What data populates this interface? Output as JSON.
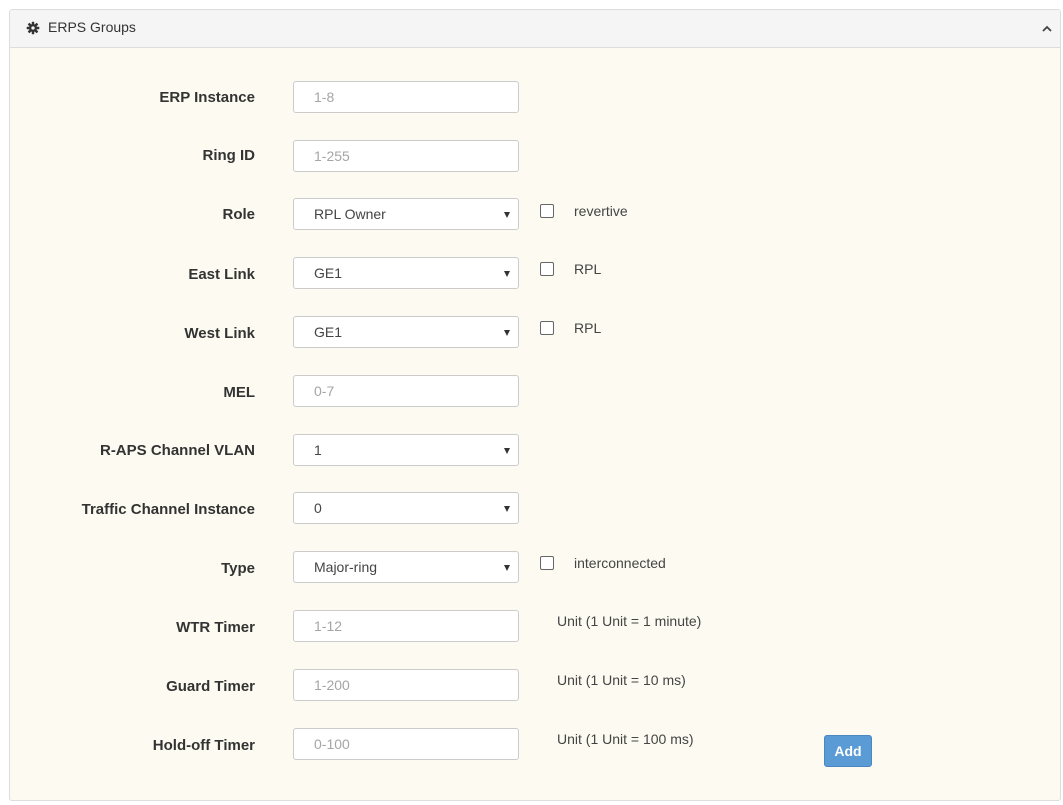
{
  "panel": {
    "title": "ERPS Groups",
    "icon": "gear-icon",
    "collapse_icon": "chevron-up-icon"
  },
  "fields": {
    "erp_instance": {
      "label": "ERP Instance",
      "placeholder": "1-8"
    },
    "ring_id": {
      "label": "Ring ID",
      "placeholder": "1-255"
    },
    "role": {
      "label": "Role",
      "value": "RPL Owner",
      "checkbox_label": "revertive",
      "checked": false
    },
    "east_link": {
      "label": "East Link",
      "value": "GE1",
      "checkbox_label": "RPL",
      "checked": false
    },
    "west_link": {
      "label": "West Link",
      "value": "GE1",
      "checkbox_label": "RPL",
      "checked": false
    },
    "mel": {
      "label": "MEL",
      "placeholder": "0-7"
    },
    "raps_vlan": {
      "label": "R-APS Channel VLAN",
      "value": "1"
    },
    "traffic_inst": {
      "label": "Traffic Channel Instance",
      "value": "0"
    },
    "type": {
      "label": "Type",
      "value": "Major-ring",
      "checkbox_label": "interconnected",
      "checked": false
    },
    "wtr_timer": {
      "label": "WTR Timer",
      "placeholder": "1-12",
      "unit": "Unit (1 Unit = 1 minute)"
    },
    "guard_timer": {
      "label": "Guard Timer",
      "placeholder": "1-200",
      "unit": "Unit (1 Unit = 10 ms)"
    },
    "holdoff_timer": {
      "label": "Hold-off Timer",
      "placeholder": "0-100",
      "unit": "Unit (1 Unit = 100 ms)"
    }
  },
  "actions": {
    "add_label": "Add"
  },
  "colors": {
    "panel_bg": "#fdfbf1",
    "header_bg": "#f5f5f5",
    "button": "#5a9bd5"
  }
}
